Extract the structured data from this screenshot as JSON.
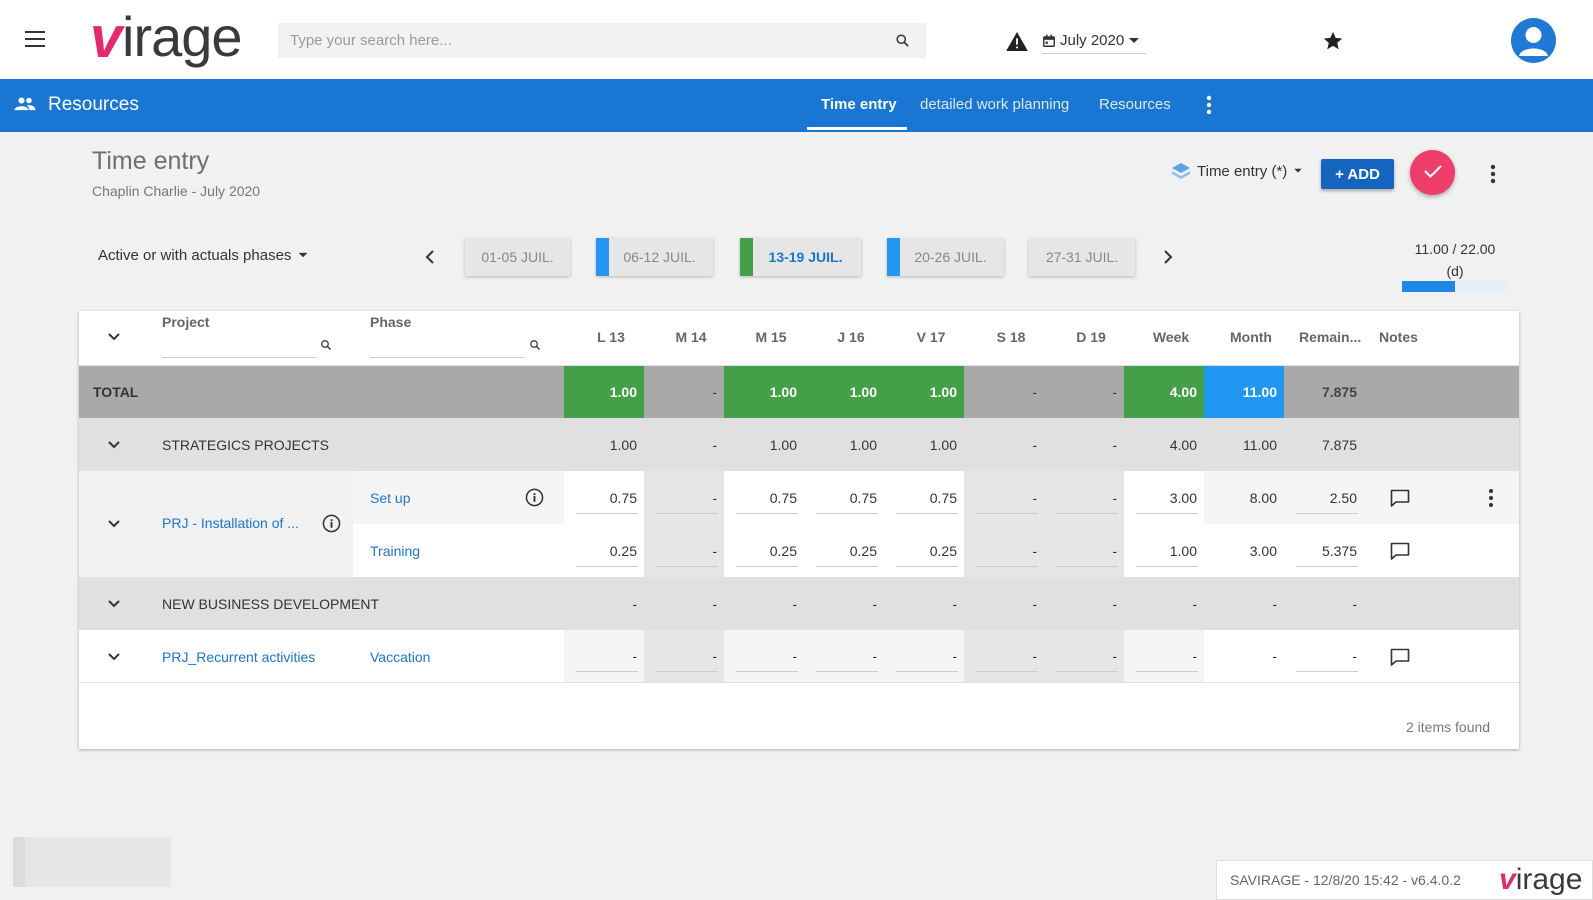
{
  "app": {
    "logo_v": "v",
    "logo_rest": "irage",
    "search_placeholder": "Type your search here...",
    "date_label": "July 2020"
  },
  "nav": {
    "title": "Resources",
    "tabs": [
      {
        "label": "Time entry",
        "active": true
      },
      {
        "label": "detailed work planning",
        "active": false
      },
      {
        "label": "Resources",
        "active": false
      }
    ]
  },
  "page": {
    "title": "Time entry",
    "subtitle": "Chaplin Charlie - July 2020",
    "view_label": "Time entry (*)",
    "add_label": "+ ADD"
  },
  "toolbar": {
    "phase_filter": "Active or with actuals phases",
    "weeks": [
      {
        "label": "01-05 JUIL.",
        "stripe": null,
        "current": false
      },
      {
        "label": "06-12 JUIL.",
        "stripe": "#2196f3",
        "current": false
      },
      {
        "label": "13-19 JUIL.",
        "stripe": "#43a047",
        "current": true
      },
      {
        "label": "20-26 JUIL.",
        "stripe": "#2196f3",
        "current": false
      },
      {
        "label": "27-31 JUIL.",
        "stripe": null,
        "current": false
      }
    ],
    "progress_text": "11.00 / 22.00",
    "progress_unit": "(d)",
    "progress_fraction": 0.5
  },
  "table": {
    "headers": {
      "project": "Project",
      "phase": "Phase",
      "days": [
        "L 13",
        "M 14",
        "M 15",
        "J 16",
        "V 17",
        "S 18",
        "D 19"
      ],
      "week": "Week",
      "month": "Month",
      "remaining": "Remain...",
      "notes": "Notes"
    },
    "total": {
      "label": "TOTAL",
      "days": [
        "1.00",
        "-",
        "1.00",
        "1.00",
        "1.00",
        "-",
        "-"
      ],
      "week": "4.00",
      "month": "11.00",
      "remaining": "7.875"
    },
    "groups": [
      {
        "name": "STRATEGICS PROJECTS",
        "days": [
          "1.00",
          "-",
          "1.00",
          "1.00",
          "1.00",
          "-",
          "-"
        ],
        "week": "4.00",
        "month": "11.00",
        "remaining": "7.875"
      },
      {
        "name": "NEW BUSINESS DEVELOPMENT",
        "days": [
          "-",
          "-",
          "-",
          "-",
          "-",
          "-",
          "-"
        ],
        "week": "-",
        "month": "-",
        "remaining": "-"
      }
    ],
    "projects": [
      {
        "name": "PRJ - Installation of ...",
        "phases": [
          {
            "name": "Set up",
            "days": [
              "0.75",
              "-",
              "0.75",
              "0.75",
              "0.75",
              "-",
              "-"
            ],
            "week": "3.00",
            "month": "8.00",
            "remaining": "2.50"
          },
          {
            "name": "Training",
            "days": [
              "0.25",
              "-",
              "0.25",
              "0.25",
              "0.25",
              "-",
              "-"
            ],
            "week": "1.00",
            "month": "3.00",
            "remaining": "5.375"
          }
        ]
      },
      {
        "name": "PRJ_Recurrent activities",
        "phases": [
          {
            "name": "Vaccation",
            "days": [
              "-",
              "-",
              "-",
              "-",
              "-",
              "-",
              "-"
            ],
            "week": "-",
            "month": "-",
            "remaining": "-"
          }
        ]
      }
    ],
    "items_found": "2 items found"
  },
  "footer": {
    "version": "SAVIRAGE - 12/8/20 15:42 - v6.4.0.2",
    "logo_v": "v",
    "logo_rest": "irage"
  },
  "colors": {
    "nav_blue": "#1976d2",
    "total_green": "#43a047",
    "month_blue": "#2196f3",
    "accent_pink": "#ef3d6a",
    "weekend_gray": "#e6e6e6"
  }
}
